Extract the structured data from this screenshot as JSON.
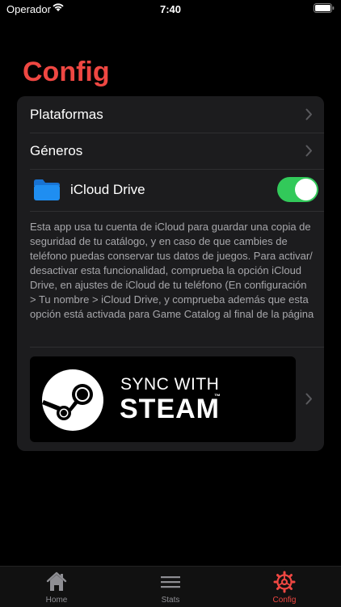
{
  "status_bar": {
    "carrier": "Operador",
    "time": "7:40"
  },
  "page": {
    "title": "Config"
  },
  "settings": {
    "rows": [
      {
        "label": "Plataformas"
      },
      {
        "label": "Géneros"
      }
    ],
    "icloud": {
      "label": "iCloud Drive",
      "enabled": true
    },
    "description": "Esta app usa tu cuenta de iCloud para guardar una copia de seguridad de tu catálogo, y en caso de que cambies de teléfono puedas conservar tus datos de juegos. Para activar/ desactivar esta funcionalidad, comprueba la opción iCloud Drive, en ajustes de iCloud de tu teléfono (En configuración > Tu nombre > iCloud Drive, y comprueba además que esta opción está activada para Game Catalog al final de la página",
    "steam": {
      "line1": "SYNC WITH",
      "line2": "STEAM",
      "tm": "™"
    }
  },
  "tabs": [
    {
      "label": "Home",
      "icon": "house-icon",
      "active": false
    },
    {
      "label": "Stats",
      "icon": "list-icon",
      "active": false
    },
    {
      "label": "Config",
      "icon": "gear-icon",
      "active": true
    }
  ],
  "colors": {
    "accent": "#ef4742",
    "toggle_on": "#32c95a",
    "folder": "#1f8ef1"
  }
}
